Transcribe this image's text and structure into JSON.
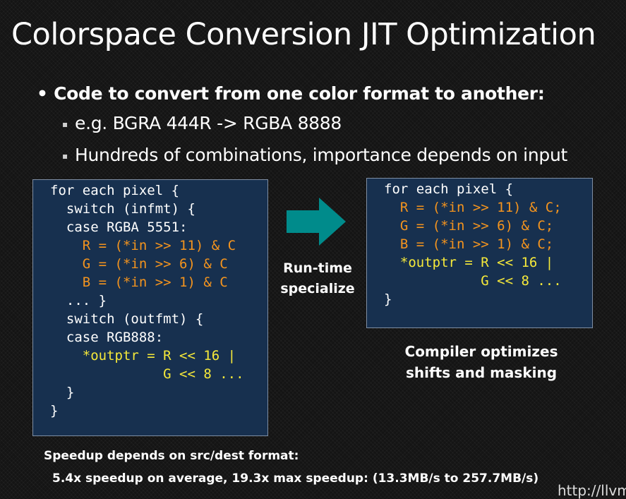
{
  "title": "Colorspace Conversion JIT Optimization",
  "bullet": "Code to convert from one color format to another:",
  "bullet_mark": "•",
  "sub_mark": "▪",
  "sub_items": [
    "e.g. BGRA 444R -> RGBA 8888",
    "Hundreds of combinations, importance depends on input"
  ],
  "code_left": [
    "for each pixel {",
    "  switch (infmt) {",
    "  case RGBA 5551:",
    "    R = (*in >> 11) & C",
    "    G = (*in >> 6) & C",
    "    B = (*in >> 1) & C",
    "  ... }",
    "  switch (outfmt) {",
    "  case RGB888:",
    "    *outptr = R << 16 |",
    "              G << 8 ...",
    "  }",
    "}"
  ],
  "code_right": [
    "for each pixel {",
    "  R = (*in >> 11) & C;",
    "  G = (*in >> 6) & C;",
    "  B = (*in >> 1) & C;",
    "  *outptr = R << 16 |",
    "            G << 8 ...",
    "}"
  ],
  "runtime_label": [
    "Run-time",
    "specialize"
  ],
  "compiler_label": [
    "Compiler optimizes",
    "shifts and masking"
  ],
  "speedup_heading": "Speedup depends on src/dest format:",
  "speedup_detail": "5.4x speedup on average, 19.3x max speedup: (13.3MB/s to 257.7MB/s)",
  "url_fragment": "http://llvm",
  "colors": {
    "background": "#141414",
    "code_box": "#17304f",
    "code_default": "#ffffff",
    "code_orange": "#f4941e",
    "code_yellow": "#f6e93a",
    "arrow": "#008b8b"
  }
}
